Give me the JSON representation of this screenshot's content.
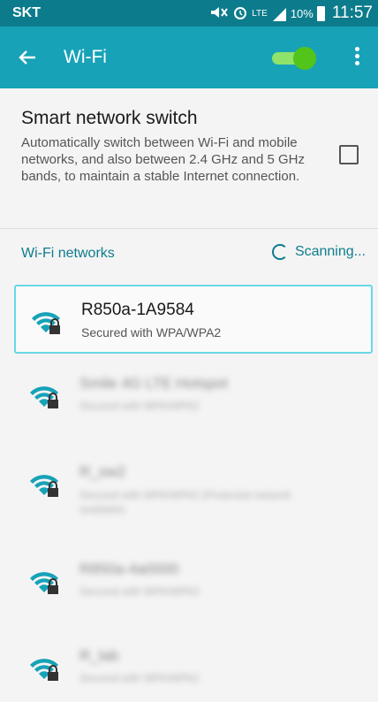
{
  "status": {
    "carrier": "SKT",
    "network": "LTE",
    "battery": "10%",
    "time": "11:57"
  },
  "appbar": {
    "title": "Wi-Fi"
  },
  "smart_switch": {
    "title": "Smart network switch",
    "description": "Automatically switch between Wi-Fi and mobile networks, and also between 2.4 GHz and 5 GHz bands, to maintain a stable Internet connection."
  },
  "wifi_section": {
    "label": "Wi-Fi networks",
    "scanning": "Scanning..."
  },
  "networks": [
    {
      "name": "R850a-1A9584",
      "security": "Secured with WPA/WPA2"
    },
    {
      "name": "Smile 4G LTE Hotspot",
      "security": "Secured with WPA/WPA2"
    },
    {
      "name": "R_sw2",
      "security": "Secured with WPA/WPA2 (Protected network available)"
    },
    {
      "name": "R850a-4a0000",
      "security": "Secured with WPA/WPA2"
    },
    {
      "name": "R_lab",
      "security": "Secured with WPA/WPA2"
    }
  ]
}
